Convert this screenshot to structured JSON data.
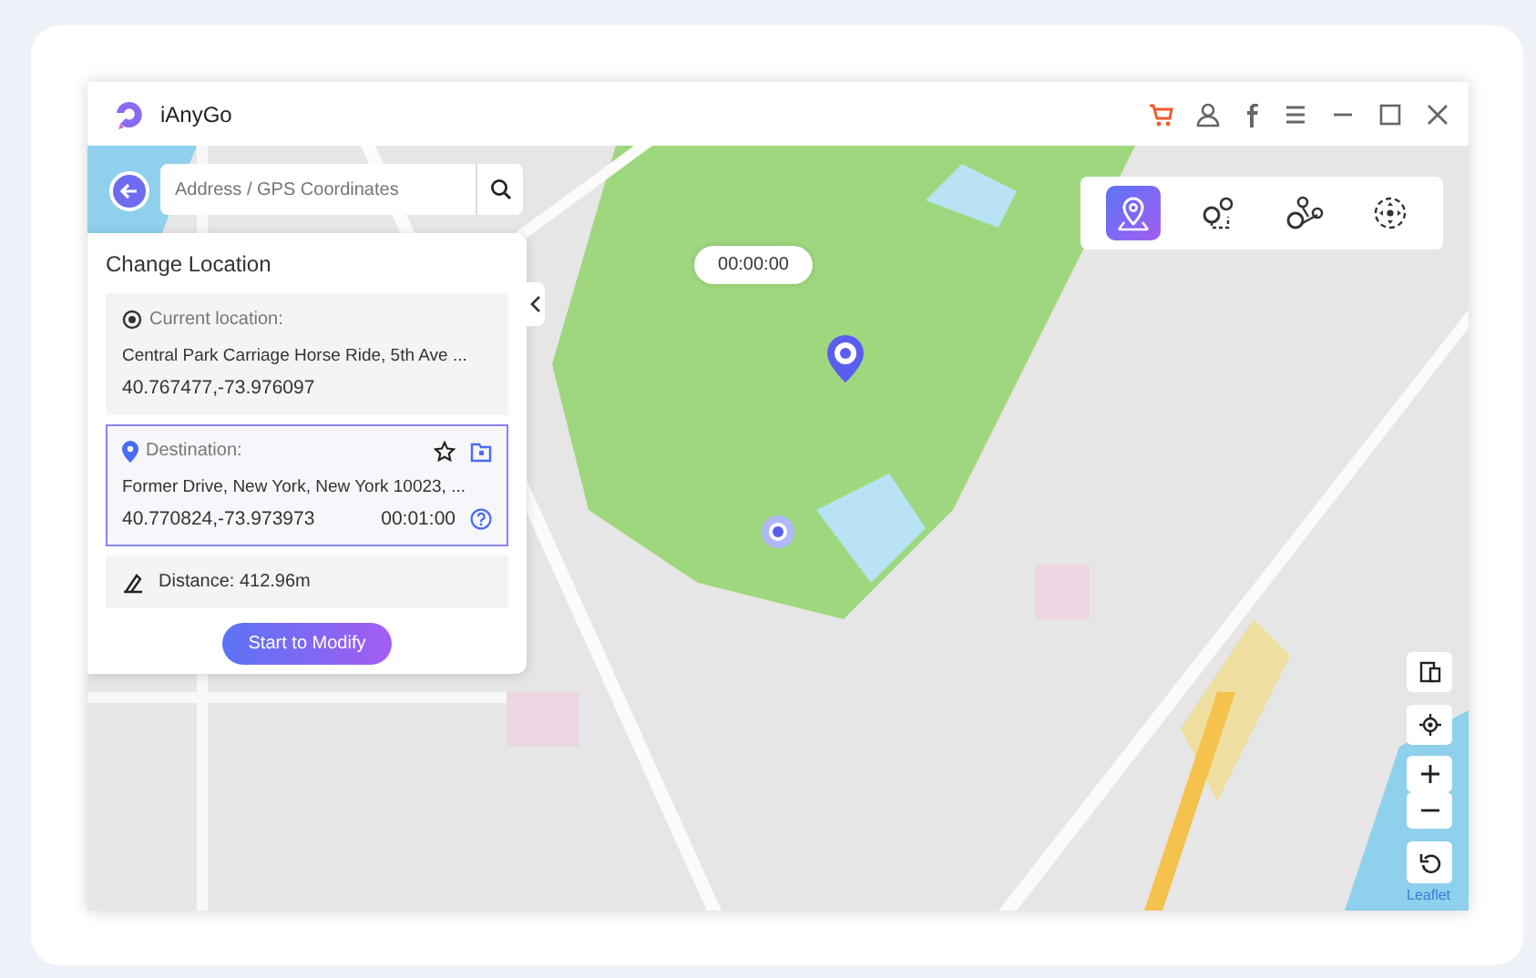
{
  "app": {
    "title": "iAnyGo"
  },
  "search": {
    "placeholder": "Address / GPS Coordinates"
  },
  "timer": "00:00:00",
  "modes": [
    {
      "selected": true
    },
    {
      "selected": false
    },
    {
      "selected": false
    },
    {
      "selected": false
    }
  ],
  "panel": {
    "title": "Change Location",
    "current": {
      "label": "Current location:",
      "address": "Central Park Carriage Horse Ride, 5th Ave ...",
      "coords": "40.767477,-73.976097",
      "selected": false
    },
    "destination": {
      "label": "Destination:",
      "address": "Former Drive, New York, New York 10023, ...",
      "coords": "40.770824,-73.973973",
      "time": "00:01:00",
      "selected": true
    },
    "distance": "Distance: 412.96m",
    "button": "Start to Modify"
  },
  "attribution": "Leaflet"
}
